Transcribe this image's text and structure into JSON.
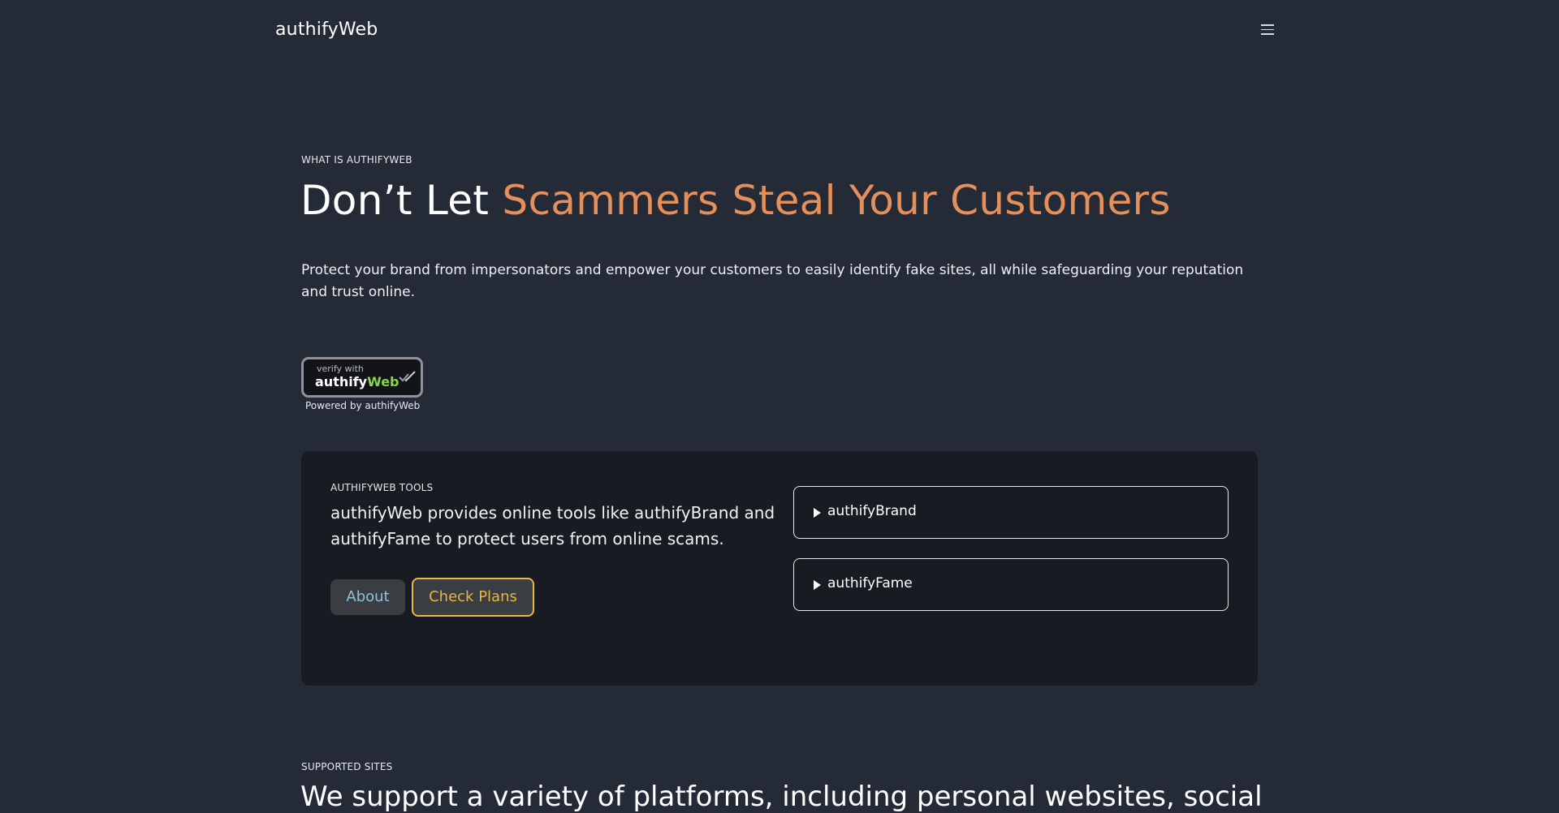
{
  "header": {
    "brand": "authifyWeb",
    "menu_icon": "hamburger-menu-icon"
  },
  "hero": {
    "eyebrow": "WHAT IS AUTHIFYWEB",
    "title_plain": "Don’t Let ",
    "title_accent": "Scammers Steal Your Customers",
    "description": "Protect your brand from impersonators and empower your customers to easily identify fake sites, all while safeguarding your reputation and trust online.",
    "accent_color": "#e58f5a"
  },
  "badge": {
    "small_text": "verify with",
    "brand_plain": "authify",
    "brand_accent": "Web",
    "check_icon": "double-check-icon",
    "powered_by": "Powered by authifyWeb"
  },
  "tools": {
    "eyebrow": "AUTHIFYWEB TOOLS",
    "description": "authifyWeb provides online tools like authifyBrand and authifyFame to protect users from online scams.",
    "about_label": "About",
    "plans_label": "Check Plans",
    "accordion": [
      {
        "label": "authifyBrand"
      },
      {
        "label": "authifyFame"
      }
    ]
  },
  "supported": {
    "eyebrow": "SUPPORTED SITES",
    "title": "We support a variety of platforms, including personal websites, social"
  }
}
